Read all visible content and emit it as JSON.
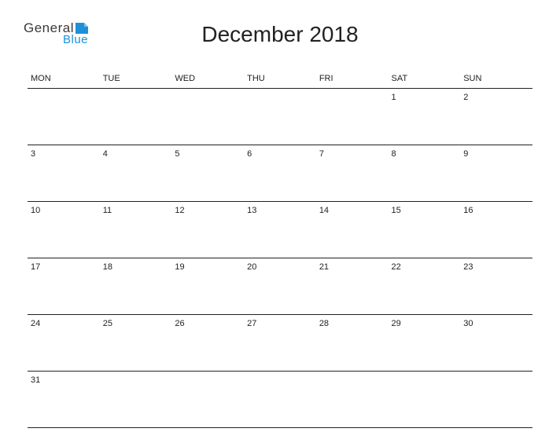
{
  "logo": {
    "general": "General",
    "blue": "Blue"
  },
  "title": "December 2018",
  "day_headers": [
    "MON",
    "TUE",
    "WED",
    "THU",
    "FRI",
    "SAT",
    "SUN"
  ],
  "weeks": [
    [
      "",
      "",
      "",
      "",
      "",
      "1",
      "2"
    ],
    [
      "3",
      "4",
      "5",
      "6",
      "7",
      "8",
      "9"
    ],
    [
      "10",
      "11",
      "12",
      "13",
      "14",
      "15",
      "16"
    ],
    [
      "17",
      "18",
      "19",
      "20",
      "21",
      "22",
      "23"
    ],
    [
      "24",
      "25",
      "26",
      "27",
      "28",
      "29",
      "30"
    ],
    [
      "31",
      "",
      "",
      "",
      "",
      "",
      ""
    ]
  ]
}
